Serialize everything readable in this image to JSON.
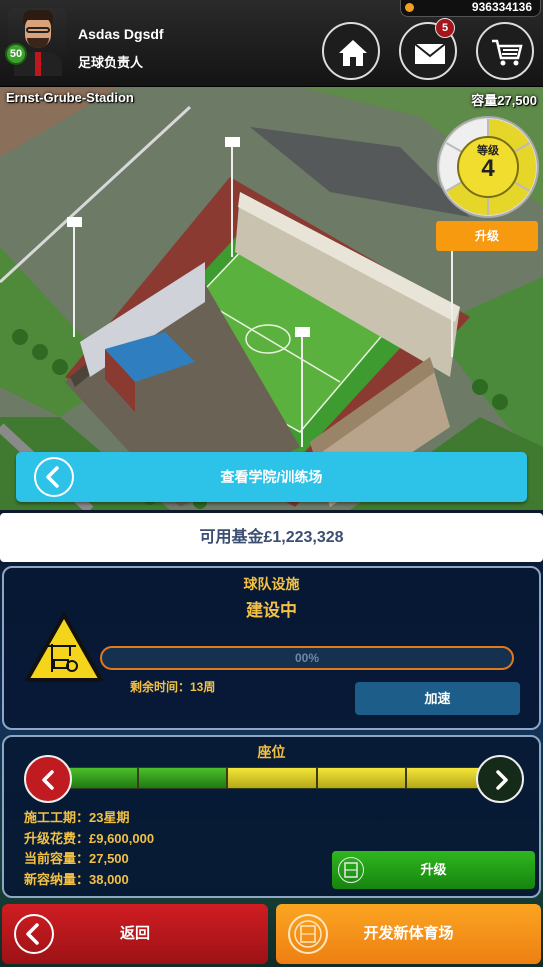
{
  "header": {
    "user_name": "Asdas Dgsdf",
    "user_role": "足球负责人",
    "level": "50",
    "coins": "936334136",
    "mail_count": "5",
    "icons": [
      "home-icon",
      "mail-icon",
      "cart-icon"
    ]
  },
  "stadium": {
    "name": "Ernst-Grube-Stadion",
    "capacity": "容量27,500",
    "level_label": "等级",
    "level_value": "4",
    "upgrade_label": "升级",
    "academy_label": "查看学院/训练场"
  },
  "funds": {
    "label": "可用基金£1,223,328"
  },
  "facility": {
    "title": "球队设施",
    "status": "建设中",
    "progress_percent": 0,
    "progress_label": "00%",
    "remaining": "剩余时间：13周",
    "speedup_label": "加速"
  },
  "seats": {
    "title": "座位",
    "segments": [
      "green",
      "green",
      "yellow",
      "yellow",
      "yellow"
    ],
    "duration": "施工工期：23星期",
    "cost": "升级花费：£9,600,000",
    "current_capacity": "当前容量：27,500",
    "new_capacity": "新容纳量：38,000",
    "upgrade_label": "升级"
  },
  "footer": {
    "back_label": "返回",
    "new_stadium_label": "开发新体育场"
  },
  "colors": {
    "accent_yellow": "#f2c044",
    "academy_blue": "#2dc2e8",
    "upgrade_orange": "#f79a10",
    "upgrade_green": "#2fb61f",
    "back_red": "#d01d22"
  }
}
